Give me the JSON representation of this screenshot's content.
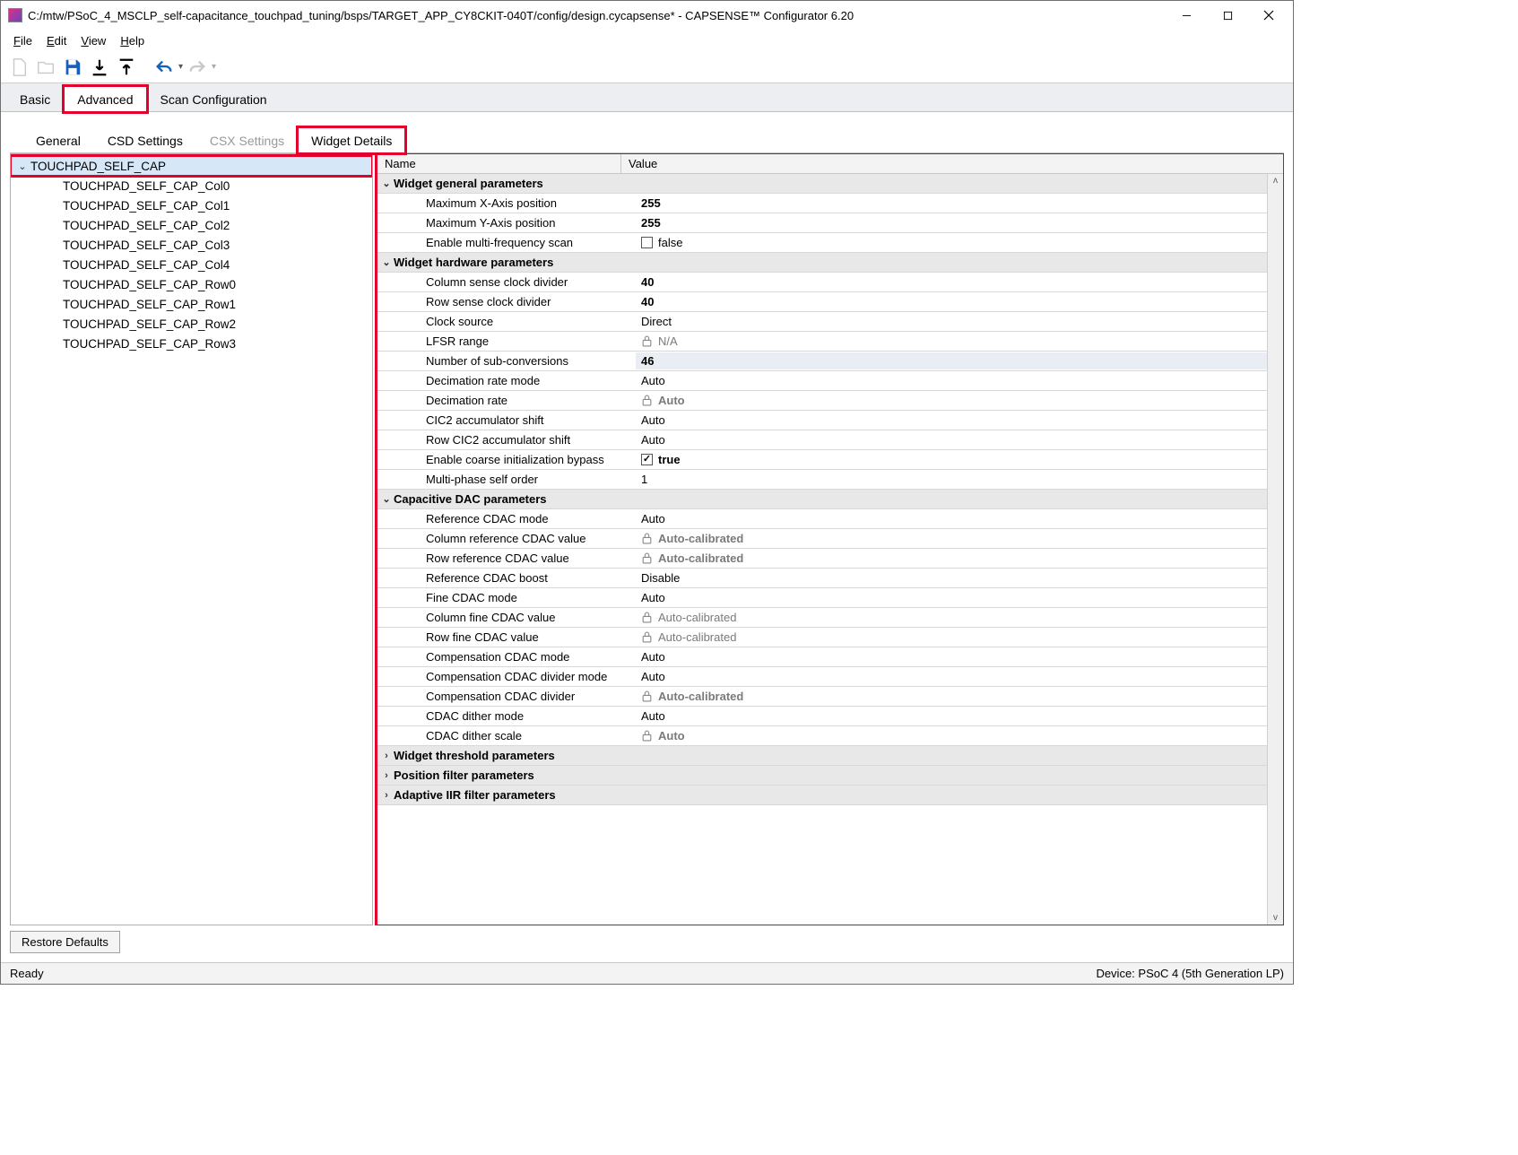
{
  "window": {
    "title": "C:/mtw/PSoC_4_MSCLP_self-capacitance_touchpad_tuning/bsps/TARGET_APP_CY8CKIT-040T/config/design.cycapsense* - CAPSENSE™ Configurator 6.20"
  },
  "menu": {
    "file": "File",
    "edit": "Edit",
    "view": "View",
    "help": "Help"
  },
  "mainTabs": {
    "basic": "Basic",
    "advanced": "Advanced",
    "scan": "Scan Configuration"
  },
  "subTabs": {
    "general": "General",
    "csd": "CSD Settings",
    "csx": "CSX Settings",
    "widget": "Widget Details"
  },
  "tree": {
    "root": "TOUCHPAD_SELF_CAP",
    "children": [
      "TOUCHPAD_SELF_CAP_Col0",
      "TOUCHPAD_SELF_CAP_Col1",
      "TOUCHPAD_SELF_CAP_Col2",
      "TOUCHPAD_SELF_CAP_Col3",
      "TOUCHPAD_SELF_CAP_Col4",
      "TOUCHPAD_SELF_CAP_Row0",
      "TOUCHPAD_SELF_CAP_Row1",
      "TOUCHPAD_SELF_CAP_Row2",
      "TOUCHPAD_SELF_CAP_Row3"
    ]
  },
  "grid": {
    "head": {
      "name": "Name",
      "value": "Value"
    },
    "sections": {
      "general": "Widget general parameters",
      "hardware": "Widget hardware parameters",
      "cdac": "Capacitive DAC parameters",
      "threshold": "Widget threshold parameters",
      "posfilter": "Position filter parameters",
      "iir": "Adaptive IIR filter parameters"
    },
    "p": {
      "maxx": {
        "n": "Maximum X-Axis position",
        "v": "255"
      },
      "maxy": {
        "n": "Maximum Y-Axis position",
        "v": "255"
      },
      "emfs": {
        "n": "Enable multi-frequency scan",
        "v": "false"
      },
      "colclk": {
        "n": "Column sense clock divider",
        "v": "40"
      },
      "rowclk": {
        "n": "Row sense clock divider",
        "v": "40"
      },
      "clksrc": {
        "n": "Clock source",
        "v": "Direct"
      },
      "lfsr": {
        "n": "LFSR range",
        "v": "N/A"
      },
      "nsub": {
        "n": "Number of sub-conversions",
        "v": "46"
      },
      "decmode": {
        "n": "Decimation rate mode",
        "v": "Auto"
      },
      "decrate": {
        "n": "Decimation rate",
        "v": "Auto"
      },
      "cic2": {
        "n": "CIC2 accumulator shift",
        "v": "Auto"
      },
      "rcic2": {
        "n": "Row CIC2 accumulator shift",
        "v": "Auto"
      },
      "coarse": {
        "n": "Enable coarse initialization bypass",
        "v": "true"
      },
      "mpso": {
        "n": "Multi-phase self order",
        "v": "1"
      },
      "refmode": {
        "n": "Reference CDAC mode",
        "v": "Auto"
      },
      "colref": {
        "n": "Column reference CDAC value",
        "v": "Auto-calibrated"
      },
      "rowref": {
        "n": "Row reference CDAC value",
        "v": "Auto-calibrated"
      },
      "refboost": {
        "n": "Reference CDAC boost",
        "v": "Disable"
      },
      "finemode": {
        "n": "Fine CDAC mode",
        "v": "Auto"
      },
      "colfine": {
        "n": "Column fine CDAC value",
        "v": "Auto-calibrated"
      },
      "rowfine": {
        "n": "Row fine CDAC value",
        "v": "Auto-calibrated"
      },
      "compmode": {
        "n": "Compensation CDAC mode",
        "v": "Auto"
      },
      "compdivmode": {
        "n": "Compensation CDAC divider mode",
        "v": "Auto"
      },
      "compdiv": {
        "n": "Compensation CDAC divider",
        "v": "Auto-calibrated"
      },
      "dithmode": {
        "n": "CDAC dither mode",
        "v": "Auto"
      },
      "dithscale": {
        "n": "CDAC dither scale",
        "v": "Auto"
      }
    }
  },
  "buttons": {
    "restore": "Restore Defaults"
  },
  "status": {
    "ready": "Ready",
    "device": "Device: PSoC 4 (5th Generation LP)"
  }
}
